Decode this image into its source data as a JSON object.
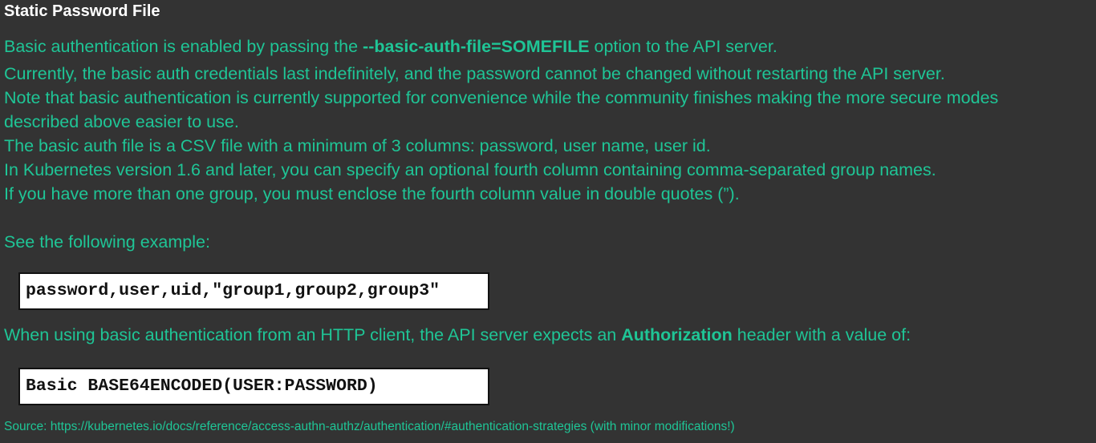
{
  "slide": {
    "title": "Static Password File",
    "line1": {
      "before": "Basic authentication is enabled by passing the ",
      "bold": "--basic-auth-file=SOMEFILE",
      "after": " option to the API server."
    },
    "line2": "Currently, the basic auth credentials last indefinitely, and the password cannot be changed without restarting the API server.",
    "line3": "Note that basic authentication is currently supported for convenience while the community finishes making the more secure modes",
    "line4": "described above easier to use.",
    "line5": "The basic auth file is a CSV file with a minimum of 3 columns: password, user name, user id.",
    "line6": "In Kubernetes version 1.6 and later, you can specify an optional fourth column containing comma-separated group names.",
    "line7": "If you have more than one group, you must enclose the fourth column value in double quotes (”).",
    "example_intro": "See the following example:",
    "code1": "password,user,uid,\"group1,group2,group3\"",
    "header_line": {
      "before": "When using basic authentication from an HTTP client, the API server expects an ",
      "bold": "Authorization",
      "after": " header with a value of:"
    },
    "code2": "Basic BASE64ENCODED(USER:PASSWORD)",
    "source": "Source: https://kubernetes.io/docs/reference/access-authn-authz/authentication/#authentication-strategies (with minor modifications!)"
  },
  "colors": {
    "background": "#333333",
    "text_accent": "#1fc596",
    "title": "#ffffff",
    "code_background": "#ffffff"
  }
}
